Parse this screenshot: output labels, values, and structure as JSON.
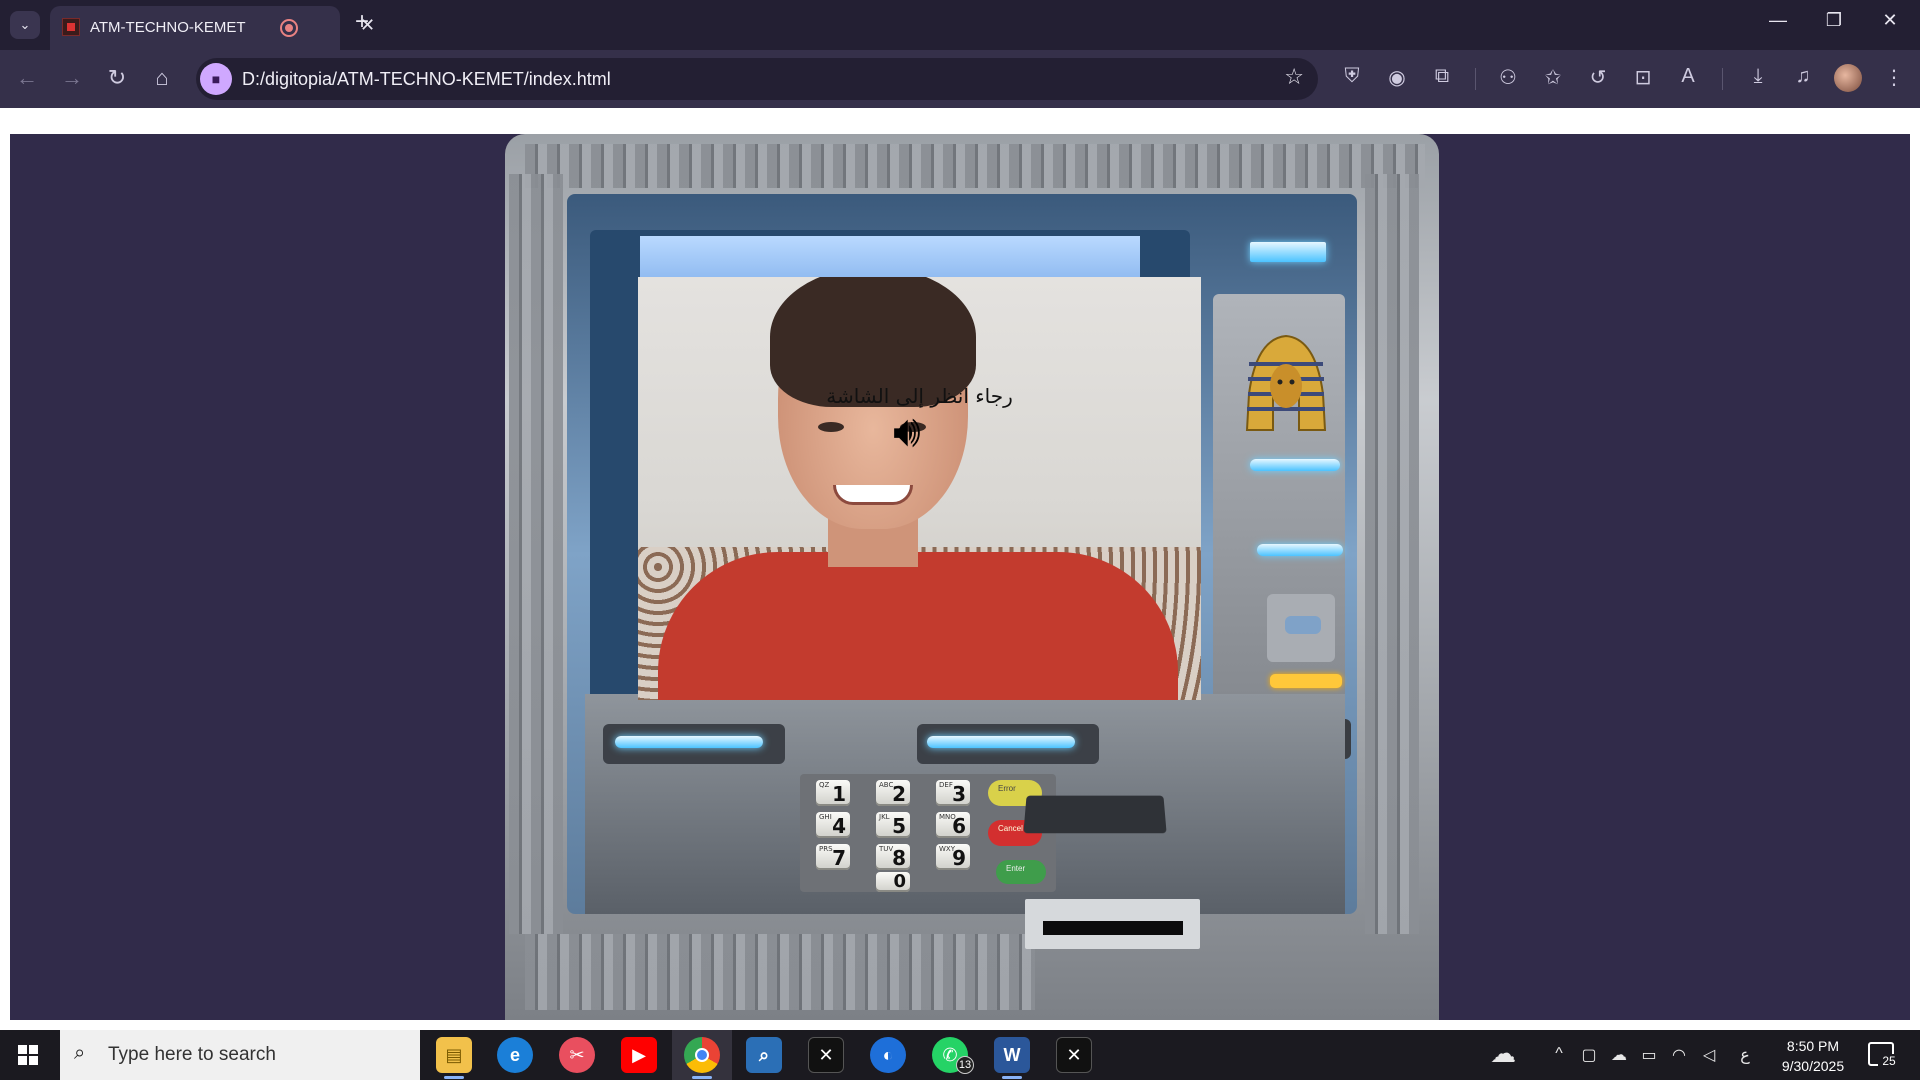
{
  "browser": {
    "tab_title": "ATM-TECHNO-KEMET",
    "url": "D:/digitopia/ATM-TECHNO-KEMET/index.html"
  },
  "atm": {
    "prompt_text": "رجاء انظر إلى الشاشة",
    "keypad": {
      "keys": [
        {
          "num": "1",
          "sub": "QZ"
        },
        {
          "num": "2",
          "sub": "ABC"
        },
        {
          "num": "3",
          "sub": "DEF"
        },
        {
          "num": "4",
          "sub": "GHI"
        },
        {
          "num": "5",
          "sub": "JKL"
        },
        {
          "num": "6",
          "sub": "MNO"
        },
        {
          "num": "7",
          "sub": "PRS"
        },
        {
          "num": "8",
          "sub": "TUV"
        },
        {
          "num": "9",
          "sub": "WXY"
        },
        {
          "num": "0",
          "sub": ""
        }
      ],
      "error_label": "Error",
      "cancel_label": "Cancel",
      "enter_label": "Enter"
    }
  },
  "taskbar": {
    "search_placeholder": "Type here to search",
    "whatsapp_badge": "13",
    "time": "8:50 PM",
    "date": "9/30/2025",
    "notification_count": "25",
    "lang_indicator": "ع"
  }
}
